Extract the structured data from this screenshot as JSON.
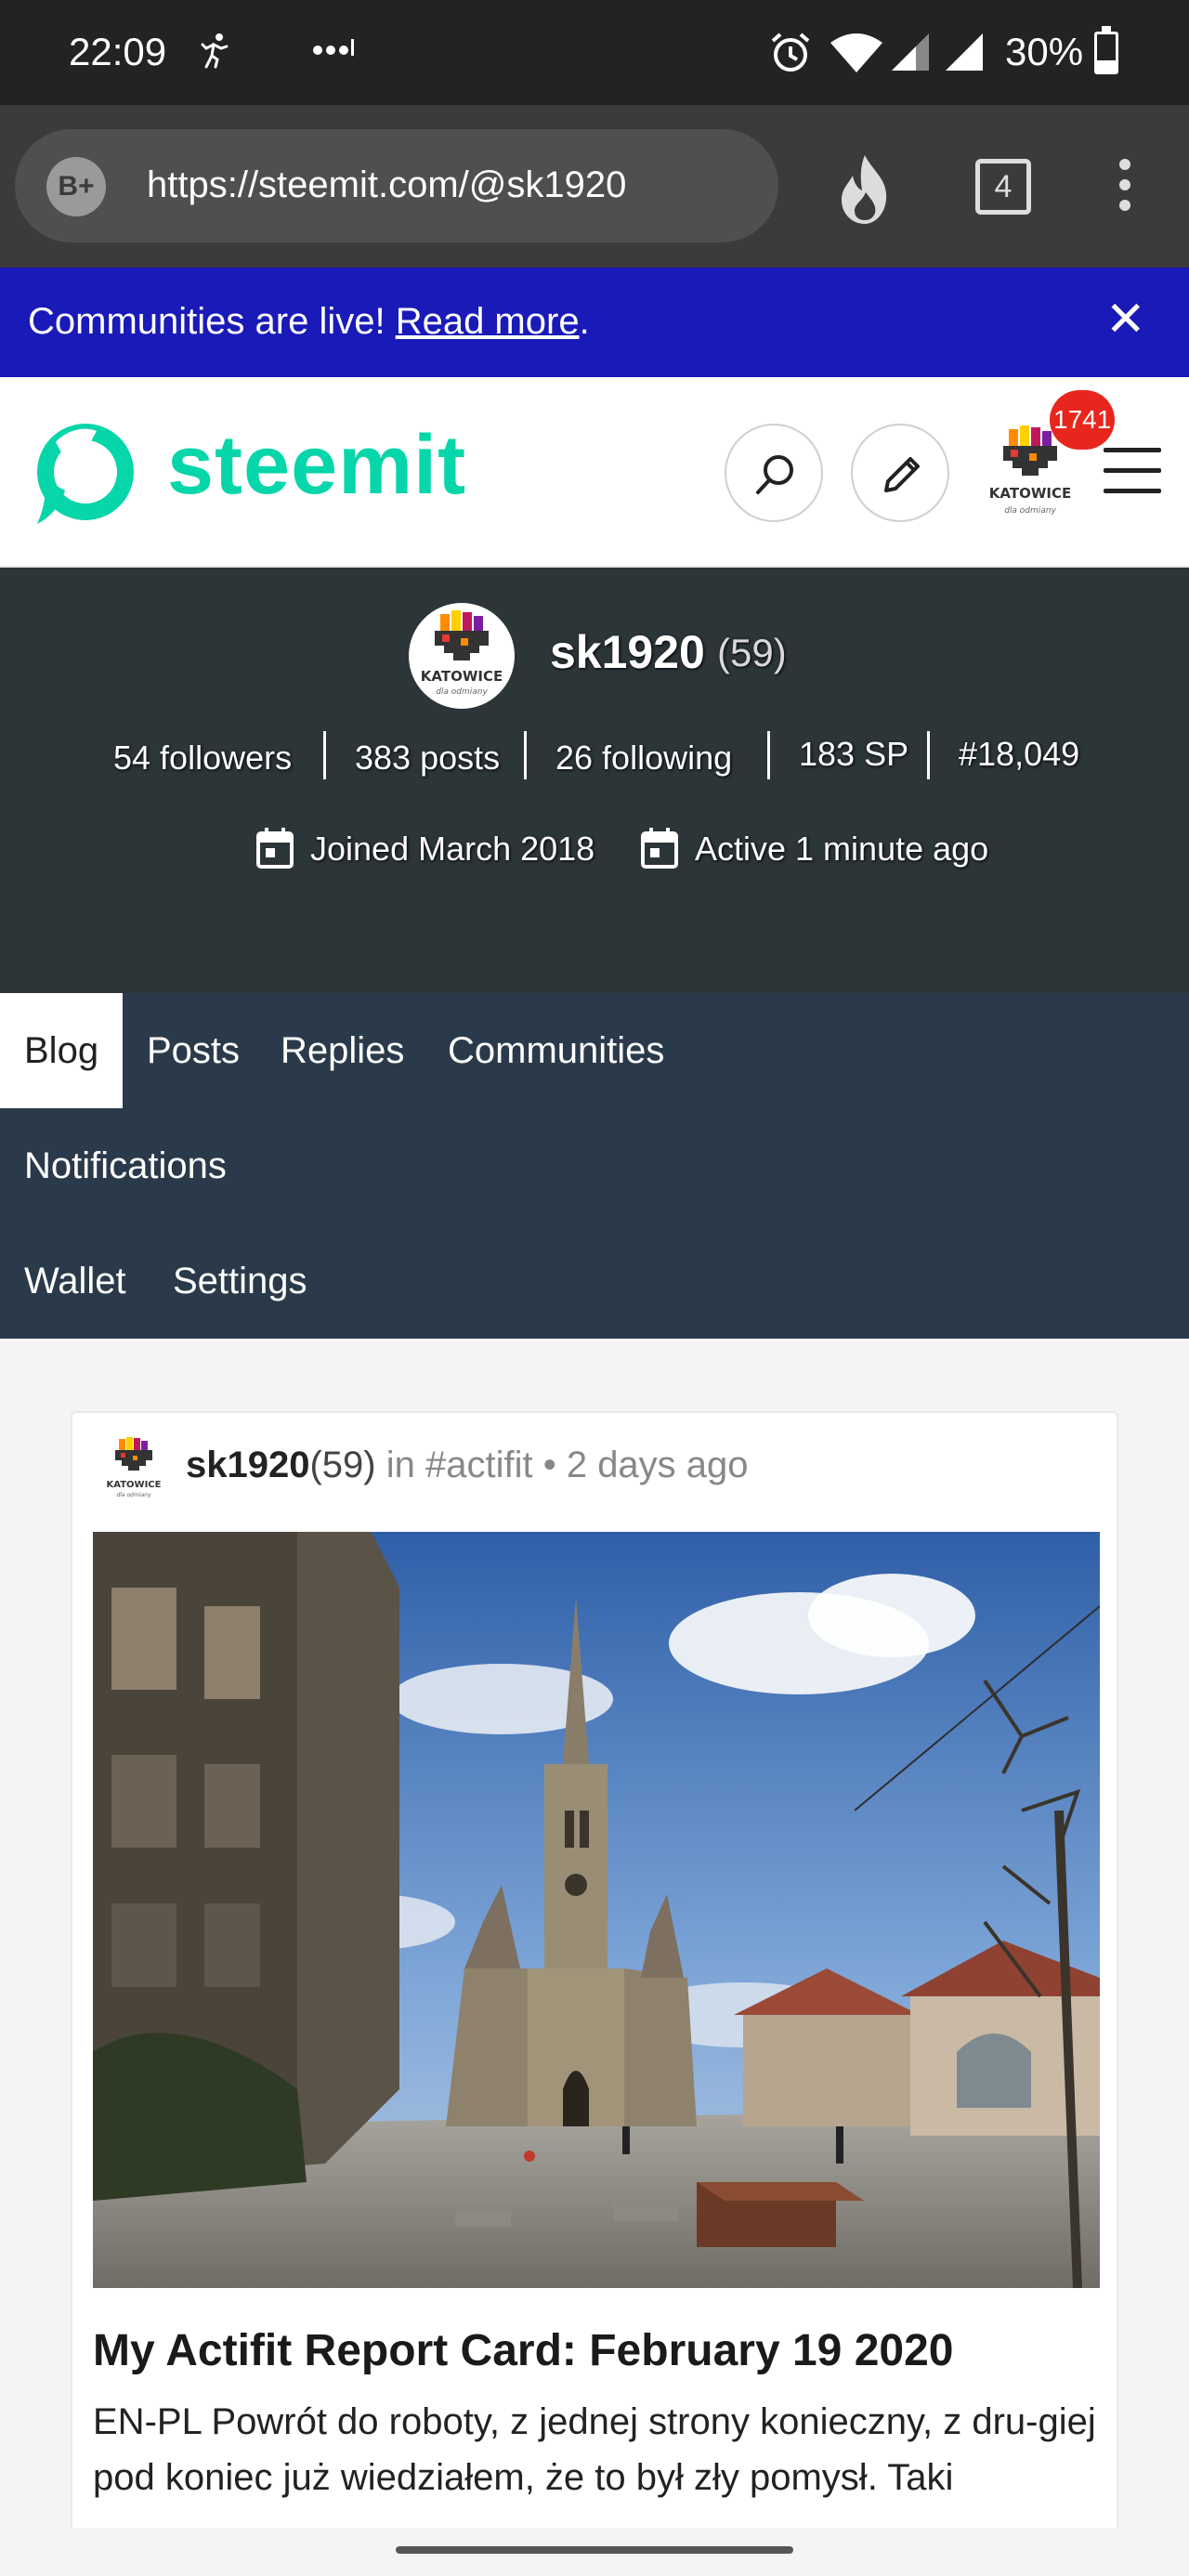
{
  "status_bar": {
    "time": "22:09",
    "battery": "30%",
    "battery_level": 0.3,
    "icons": [
      "running-icon",
      "more-dots-icon",
      "alarm-icon",
      "wifi-icon",
      "signal-icon",
      "signal-icon",
      "battery-icon"
    ]
  },
  "browser": {
    "url": "https://steemit.com/@sk1920",
    "tab_count": "4",
    "icons": [
      "b-plus-icon",
      "flame-icon",
      "tabs-icon",
      "kebab-menu-icon"
    ]
  },
  "notice": {
    "text": "Communities are live! ",
    "link_text": "Read more",
    "suffix": ".",
    "close": "✕"
  },
  "header": {
    "brand": "steemit",
    "notification_count": "1741",
    "avatar_caption": "KATOWICE",
    "avatar_sub": "dla odmiany",
    "icons": [
      "steemit-logo-icon",
      "search-icon",
      "pencil-icon",
      "hamburger-menu-icon"
    ]
  },
  "profile": {
    "username": "sk1920",
    "reputation": "(59)",
    "stats": [
      "54 followers",
      "383 posts",
      "26 following",
      "183 SP",
      "#18,049"
    ],
    "joined": "Joined March 2018",
    "active": "Active 1 minute ago",
    "avatar_caption": "KATOWICE",
    "avatar_sub": "dla odmiany"
  },
  "tabs": {
    "blog": "Blog",
    "posts": "Posts",
    "replies": "Replies",
    "communities": "Communities",
    "notifications": "Notifications",
    "wallet": "Wallet",
    "settings": "Settings",
    "active": "Blog"
  },
  "post": {
    "author": "sk1920",
    "reputation": "(59)",
    "in_label": " in ",
    "community": "#actifit",
    "separator": " • ",
    "time": "2 days ago",
    "title": "My Actifit Report Card: February 19 2020",
    "excerpt": "EN-PL Powrót do roboty, z jednej strony konieczny, z dru-giej pod koniec już wiedziałem, że to był zły pomysł. Taki",
    "avatar_caption": "KATOWICE",
    "avatar_sub": "dla odmiany"
  },
  "colors": {
    "steemit_green": "#06d6a9",
    "banner_blue": "#1a1ab8",
    "profile_bg": "#2c3538",
    "nav_bg": "#2a3a4a",
    "badge_red": "#e8261d"
  }
}
